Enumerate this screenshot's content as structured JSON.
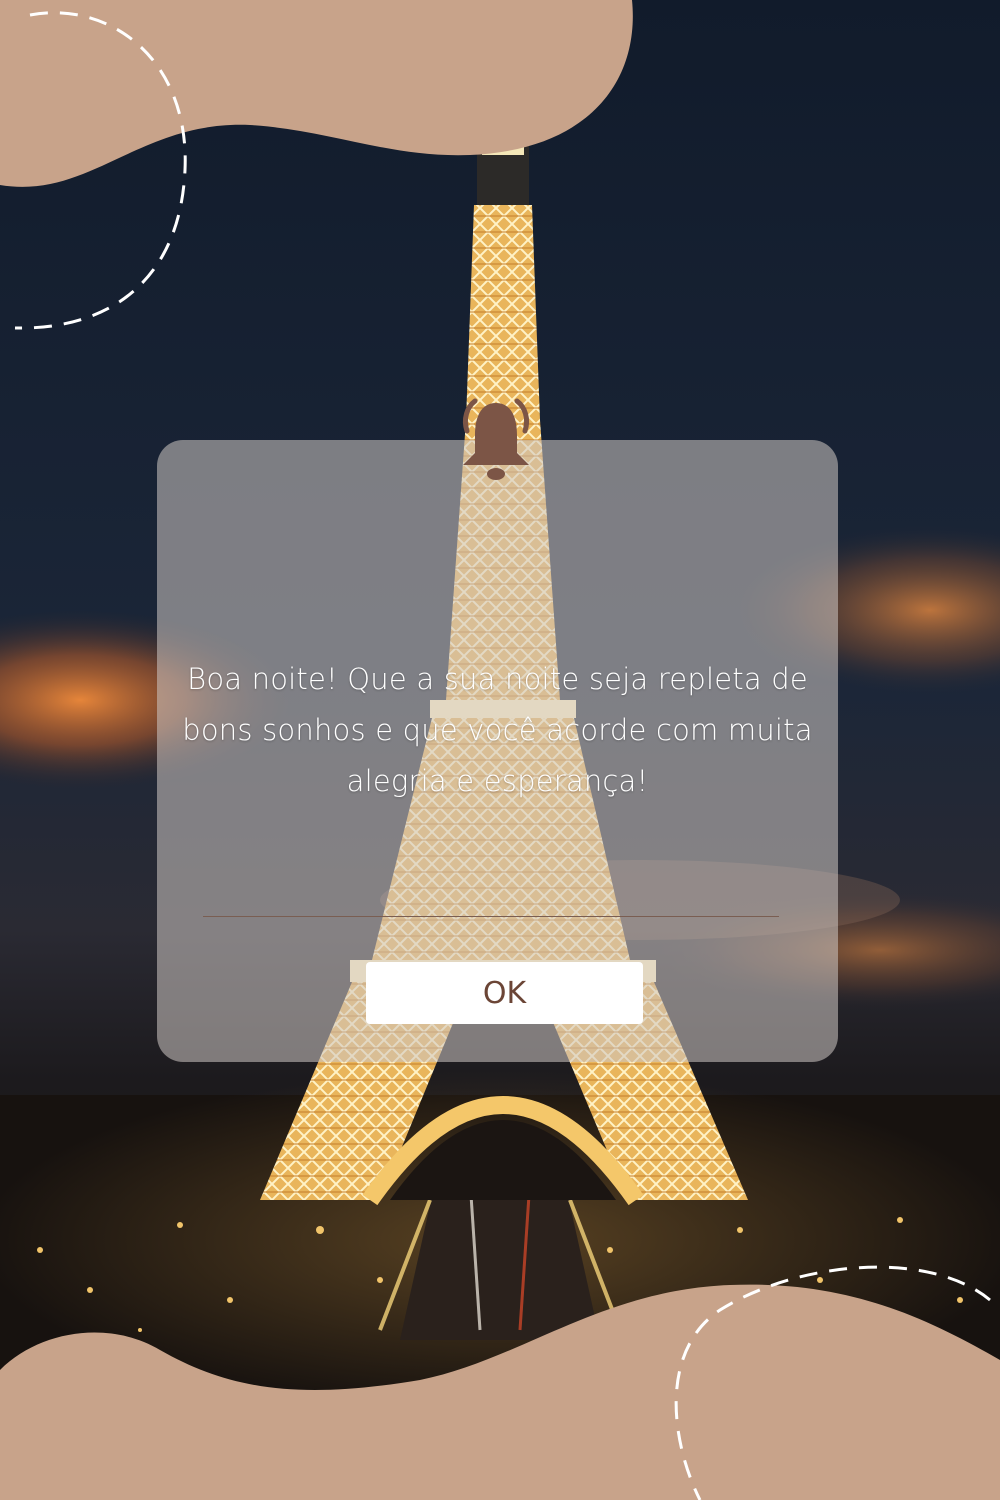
{
  "dialog": {
    "message": "Boa noite! Que a sua noite seja repleta de bons sonhos e que você acorde com muita alegria e esperança!",
    "ok_label": "OK"
  },
  "icons": {
    "notification": "bell-icon"
  },
  "colors": {
    "blob": "#c8a38a",
    "bell": "#7c5546",
    "button_text": "#6b4536",
    "night_sky": "#141d2c"
  }
}
